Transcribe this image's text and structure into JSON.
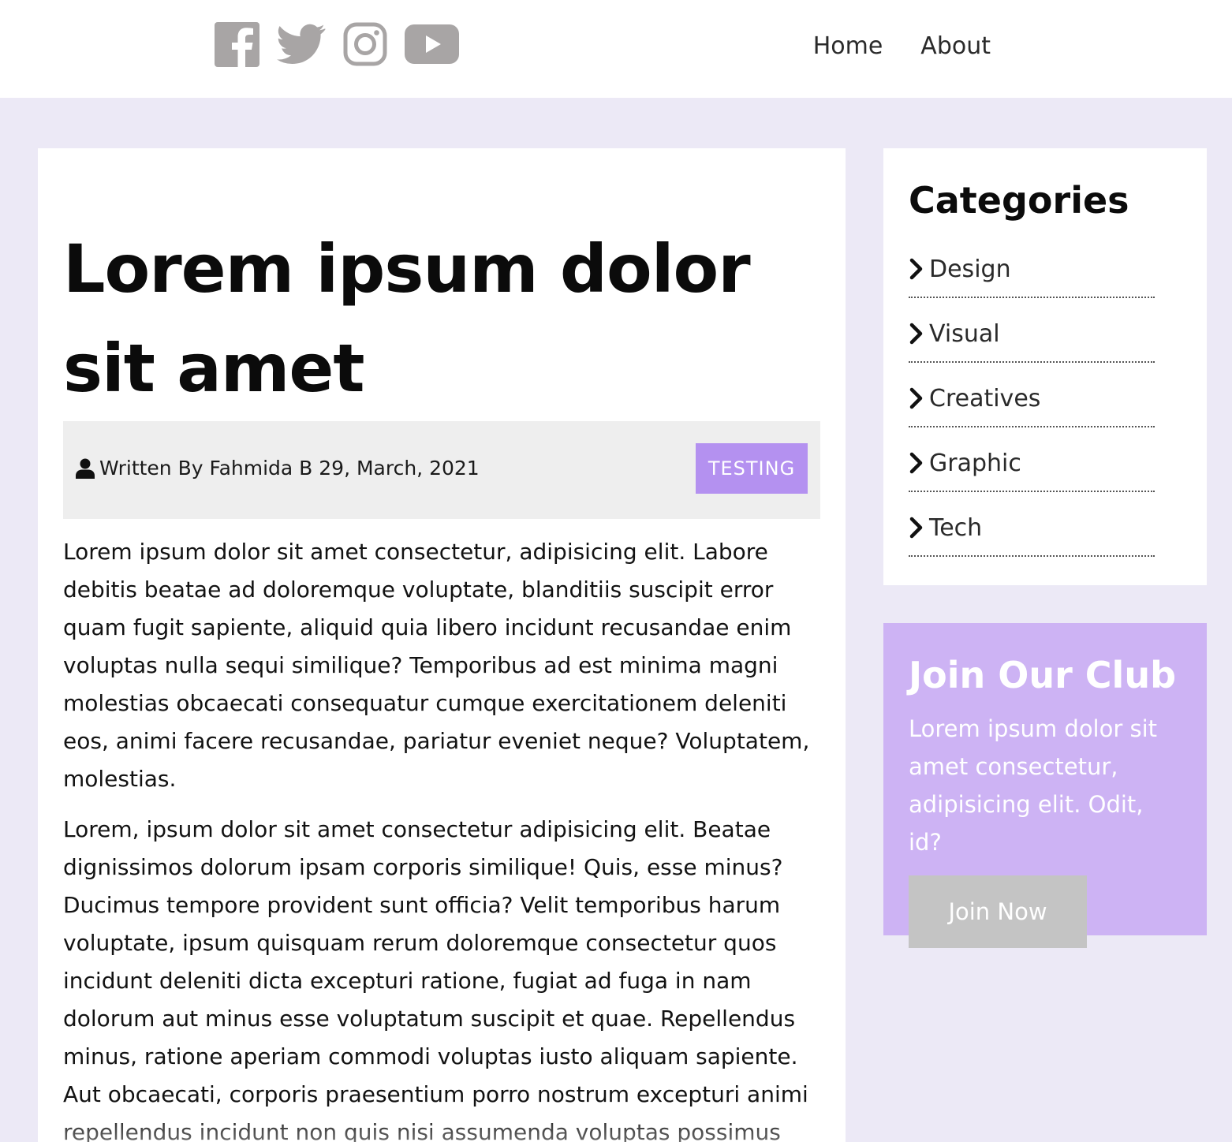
{
  "header": {
    "social": [
      {
        "name": "facebook-icon",
        "color": "#a8a5a5"
      },
      {
        "name": "twitter-icon",
        "color": "#a8a5a5"
      },
      {
        "name": "instagram-icon",
        "color": "#a8a5a5"
      },
      {
        "name": "youtube-icon",
        "color": "#a8a5a5"
      }
    ],
    "nav": [
      {
        "label": "Home"
      },
      {
        "label": "About"
      }
    ]
  },
  "article": {
    "title": "Lorem ipsum dolor sit amet",
    "author_line": "Written By Fahmida B 29, March, 2021",
    "author_icon": "user-icon",
    "tag": "TESTING",
    "paragraphs": [
      "Lorem ipsum dolor sit amet consectetur, adipisicing elit. Labore debitis beatae ad doloremque voluptate, blanditiis suscipit error quam fugit sapiente, aliquid quia libero incidunt recusandae enim voluptas nulla sequi similique? Temporibus ad est minima magni molestias obcaecati consequatur cumque exercitationem deleniti eos, animi facere recusandae, pariatur eveniet neque? Voluptatem, molestias.",
      "Lorem, ipsum dolor sit amet consectetur adipisicing elit. Beatae dignissimos dolorum ipsam corporis similique! Quis, esse minus? Ducimus tempore provident sunt officia? Velit temporibus harum voluptate, ipsum quisquam rerum doloremque consectetur quos incidunt deleniti dicta excepturi ratione, fugiat ad fuga in nam dolorum aut minus esse voluptatum suscipit et quae. Repellendus minus, ratione aperiam commodi voluptas iusto aliquam sapiente. Aut obcaecati, corporis praesentium porro nostrum excepturi animi repellendus incidunt non quis nisi assumenda voluptas possimus"
    ]
  },
  "sidebar": {
    "categories_title": "Categories",
    "categories": [
      {
        "label": "Design"
      },
      {
        "label": "Visual"
      },
      {
        "label": "Creatives"
      },
      {
        "label": "Graphic"
      },
      {
        "label": "Tech"
      }
    ],
    "club": {
      "title": "Join Our Club",
      "text": "Lorem ipsum dolor sit amet consectetur, adipisicing elit. Odit, id?",
      "button": "Join Now"
    }
  },
  "colors": {
    "page_bg": "#ece9f6",
    "tag_bg": "#b491f0",
    "club_bg": "#cdb3f4",
    "button_bg": "#c4c4c4",
    "icon_gray": "#a8a5a5"
  }
}
